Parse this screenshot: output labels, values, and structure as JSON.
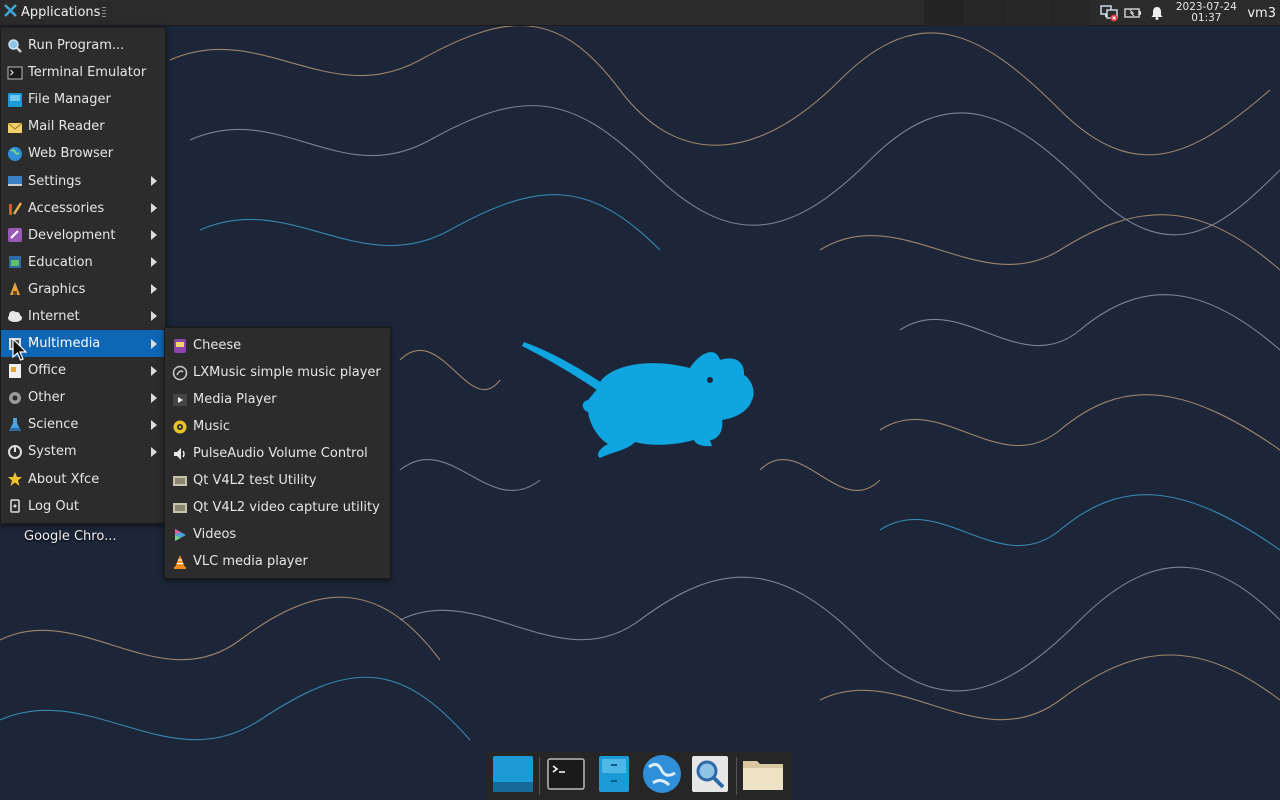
{
  "top_panel": {
    "applications_label": "Applications",
    "clock_date": "2023-07-24",
    "clock_time": "01:37",
    "user": "vm3"
  },
  "main_menu": {
    "items": [
      {
        "label": "Run Program...",
        "icon": "run-program-icon"
      },
      {
        "label": "Terminal Emulator",
        "icon": "terminal-icon"
      },
      {
        "label": "File Manager",
        "icon": "file-manager-icon"
      },
      {
        "label": "Mail Reader",
        "icon": "mail-icon"
      },
      {
        "label": "Web Browser",
        "icon": "web-browser-icon"
      },
      {
        "label": "Settings",
        "icon": "settings-icon"
      },
      {
        "label": "Accessories",
        "icon": "accessories-icon"
      },
      {
        "label": "Development",
        "icon": "development-icon"
      },
      {
        "label": "Education",
        "icon": "education-icon"
      },
      {
        "label": "Graphics",
        "icon": "graphics-icon"
      },
      {
        "label": "Internet",
        "icon": "internet-icon"
      },
      {
        "label": "Multimedia",
        "icon": "multimedia-icon"
      },
      {
        "label": "Office",
        "icon": "office-icon"
      },
      {
        "label": "Other",
        "icon": "other-icon"
      },
      {
        "label": "Science",
        "icon": "science-icon"
      },
      {
        "label": "System",
        "icon": "system-icon"
      },
      {
        "label": "About Xfce",
        "icon": "star-icon"
      },
      {
        "label": "Log Out",
        "icon": "logout-icon"
      }
    ]
  },
  "multimedia_menu": {
    "items": [
      {
        "label": "Cheese",
        "icon": "cheese-icon"
      },
      {
        "label": "LXMusic simple music player",
        "icon": "lxmusic-icon"
      },
      {
        "label": "Media Player",
        "icon": "media-player-icon"
      },
      {
        "label": "Music",
        "icon": "music-icon"
      },
      {
        "label": "PulseAudio Volume Control",
        "icon": "speaker-icon"
      },
      {
        "label": "Qt V4L2 test Utility",
        "icon": "qv4l2-icon"
      },
      {
        "label": "Qt V4L2 video capture utility",
        "icon": "qvidcap-icon"
      },
      {
        "label": "Videos",
        "icon": "videos-icon"
      },
      {
        "label": "VLC media player",
        "icon": "vlc-icon"
      }
    ]
  },
  "desktop": {
    "icon_label": "Google Chro..."
  },
  "colors": {
    "menu_bg": "#2c2c2c",
    "highlight": "#0f66b5",
    "mascot": "#0ea5e0",
    "wallpaper": "#1c2638"
  }
}
